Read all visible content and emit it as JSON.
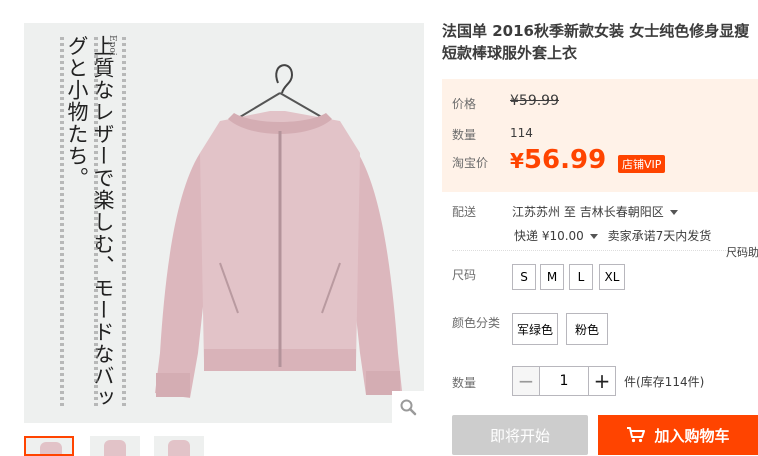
{
  "product": {
    "title": "法国单 2016秋季新款女装 女士纯色修身显瘦短款棒球服外套上衣"
  },
  "gallery": {
    "vertical_text": "上質なレザーで楽しむ、モードなバッグと小物たち。",
    "brand_mark": "Epoi",
    "thumbnail_count": 3,
    "selected_thumbnail": 1,
    "zoom_icon": "magnifier-icon"
  },
  "price": {
    "label": "价格",
    "original": "¥59.99"
  },
  "quantity_sold": {
    "label": "数量",
    "value": "114"
  },
  "promo": {
    "label": "淘宝价",
    "currency": "¥",
    "amount": "56.99",
    "badge": "店铺VIP"
  },
  "shipping": {
    "label": "配送",
    "from": "江苏苏州",
    "to_word": "至",
    "destination": "吉林长春朝阳区",
    "express": "快递 ¥10.00",
    "promise": "卖家承诺7天内发货",
    "size_helper": "尺码助"
  },
  "size": {
    "label": "尺码",
    "options": [
      "S",
      "M",
      "L",
      "XL"
    ]
  },
  "color": {
    "label": "颜色分类",
    "options": [
      "军绿色",
      "粉色"
    ]
  },
  "purchase": {
    "label": "数量",
    "value": "1",
    "minus": "−",
    "plus": "+",
    "stock": "件(库存114件)"
  },
  "buttons": {
    "coming_soon": "即将开始",
    "add_to_cart": "加入购物车",
    "cart_icon": "cart-icon"
  },
  "colors": {
    "accent": "#ff4400",
    "price_bg": "#fff2e8",
    "jacket": "#e2c3c8"
  }
}
